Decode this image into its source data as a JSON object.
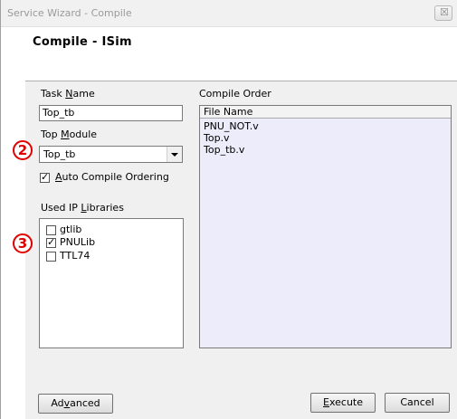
{
  "window": {
    "title": "Service Wizard - Compile",
    "close_glyph": "☒"
  },
  "header": {
    "title": "Compile - ISim"
  },
  "task_name": {
    "label_prefix": "Task ",
    "label_access": "N",
    "label_suffix": "ame",
    "value": "Top_tb"
  },
  "top_module": {
    "label_prefix": "Top ",
    "label_access": "M",
    "label_suffix": "odule",
    "value": "Top_tb",
    "marker": "2"
  },
  "auto_compile": {
    "label_access": "A",
    "label_rest": "uto Compile Ordering",
    "checked": true
  },
  "ip_libraries": {
    "label_prefix": "Used IP ",
    "label_access": "L",
    "label_suffix": "ibraries",
    "marker": "3",
    "items": [
      {
        "label": "gtlib",
        "checked": false
      },
      {
        "label": "PNULib",
        "checked": true
      },
      {
        "label": "TTL74",
        "checked": false
      }
    ]
  },
  "compile_order": {
    "label": "Compile Order",
    "column_header": "File Name",
    "files": [
      "PNU_NOT.v",
      "Top.v",
      "Top_tb.v"
    ]
  },
  "buttons": {
    "advanced_prefix": "Ad",
    "advanced_access": "v",
    "advanced_suffix": "anced",
    "execute_access": "E",
    "execute_rest": "xecute",
    "cancel": "Cancel"
  },
  "colors": {
    "marker": "#e00000",
    "order_background": "#ececfa"
  }
}
